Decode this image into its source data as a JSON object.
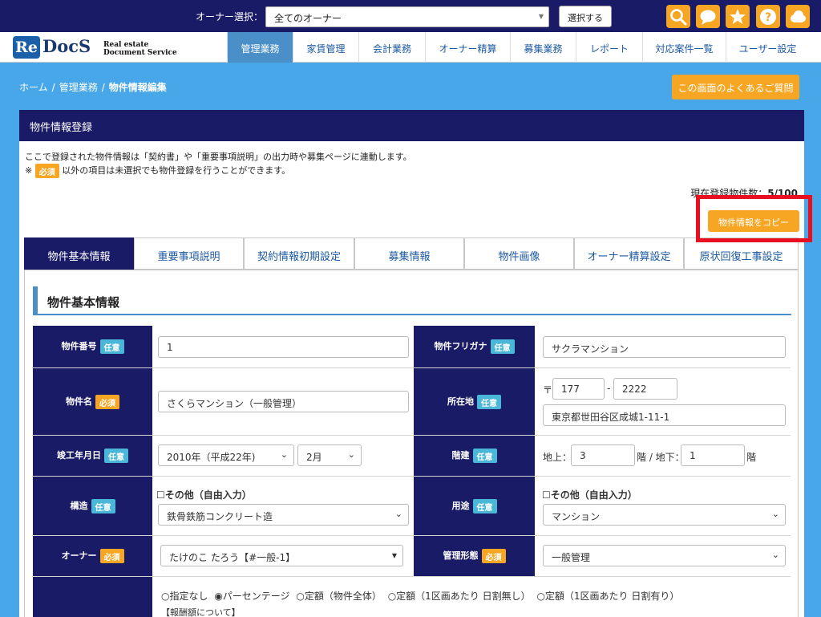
{
  "topbar": {
    "owner_label": "オーナー選択：",
    "owner_selected": "全てのオーナー",
    "select_button": "選択する",
    "icons": [
      "search-icon",
      "chat-icon",
      "star-icon",
      "help-icon",
      "cloud-icon"
    ],
    "accent_color": "#f6a623",
    "bar_color": "#191b66"
  },
  "logo": {
    "re": "Re",
    "docs": "DocS",
    "sub_line1": "Real estate",
    "sub_line2": "Document Service"
  },
  "nav": {
    "items": [
      {
        "label": "管理業務",
        "active": true
      },
      {
        "label": "家賃管理",
        "active": false
      },
      {
        "label": "会計業務",
        "active": false
      },
      {
        "label": "オーナー精算",
        "active": false
      },
      {
        "label": "募集業務",
        "active": false
      },
      {
        "label": "レポート",
        "active": false
      },
      {
        "label": "対応案件一覧",
        "active": false
      },
      {
        "label": "ユーザー設定",
        "active": false
      }
    ]
  },
  "breadcrumb": {
    "home": "ホーム",
    "section": "管理業務",
    "current": "物件情報編集",
    "sep": "/"
  },
  "faq_button": "この画面のよくあるご質問",
  "panel": {
    "title": "物件情報登録",
    "desc1": "ここで登録された物件情報は「契約書」や「重要事項説明」の出力時や募集ページに連動します。",
    "desc2_prefix": "※",
    "desc2_suffix": "以外の項目は未選択でも物件登録を行うことができます。",
    "count_label": "現在登録物件数：",
    "count_value": "5/100",
    "copy_button": "物件情報をコピー"
  },
  "badges": {
    "required": "必須",
    "optional": "任意"
  },
  "tabs": [
    "物件基本情報",
    "重要事項説明",
    "契約情報初期設定",
    "募集情報",
    "物件画像",
    "オーナー精算設定",
    "原状回復工事設定"
  ],
  "section_title": "物件基本情報",
  "form": {
    "property_no": {
      "label": "物件番号",
      "value": "1"
    },
    "property_kana": {
      "label": "物件フリガナ",
      "value": "サクラマンション"
    },
    "property_name": {
      "label": "物件名",
      "value": "さくらマンション（一般管理）"
    },
    "address": {
      "label": "所在地",
      "postal_mark": "〒",
      "postal1": "177",
      "postal_dash": "-",
      "postal2": "2222",
      "street": "東京都世田谷区成城1-11-1"
    },
    "built": {
      "label": "竣工年月日",
      "year": "2010年（平成22年)",
      "month": "2月"
    },
    "floors": {
      "label": "階建",
      "above_label": "地上：",
      "above": "3",
      "below_label": "階 / 地下：",
      "below": "1",
      "suffix": "階"
    },
    "structure": {
      "label": "構造",
      "other_checkbox": "☐その他（自由入力）",
      "value": "鉄骨鉄筋コンクリート造"
    },
    "usage": {
      "label": "用途",
      "other_checkbox": "☐その他（自由入力）",
      "value": "マンション"
    },
    "owner": {
      "label": "オーナー",
      "value": "たけのこ たろう【#一般-1】"
    },
    "management": {
      "label": "管理形態",
      "value": "一般管理"
    },
    "fee": {
      "options": [
        "○指定なし",
        "◉パーセンテージ",
        "○定額（物件全体）",
        "○定額（1区画あたり 日割無し）",
        "○定額（1区画あたり 日割有り）"
      ],
      "note": "【報酬額について】"
    }
  }
}
